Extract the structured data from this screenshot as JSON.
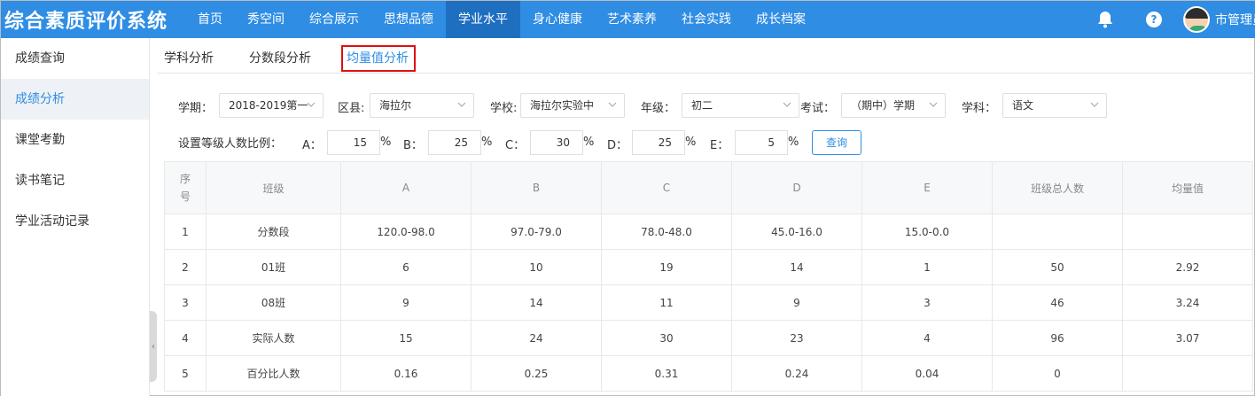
{
  "header": {
    "brand": "综合素质评价系统",
    "nav": [
      "首页",
      "秀空间",
      "综合展示",
      "思想品德",
      "学业水平",
      "身心健康",
      "艺术素养",
      "社会实践",
      "成长档案"
    ],
    "active_nav": "学业水平",
    "help_glyph": "?",
    "username": "市管理员",
    "icons": [
      "bell-icon",
      "help-icon",
      "avatar"
    ],
    "bg_color": "#2f8de4"
  },
  "sidebar": {
    "items": [
      "成绩查询",
      "成绩分析",
      "课堂考勤",
      "读书笔记",
      "学业活动记录"
    ],
    "active": "成绩分析",
    "collapse_glyph": "‹"
  },
  "tabs": {
    "items": [
      "学科分析",
      "分数段分析",
      "均量值分析"
    ],
    "active": "均量值分析"
  },
  "filters": {
    "term_label": "学期：",
    "term_value": "2018-2019第一",
    "district_label": "区县:",
    "district_value": "海拉尔",
    "school_label": "学校:",
    "school_value": "海拉尔实验中",
    "grade_label": "年级：",
    "grade_value": "初二",
    "exam_label": "考试：",
    "exam_value": "（期中）学期",
    "subject_label": "学科：",
    "subject_value": "语文",
    "ratio_label": "设置等级人数比例：",
    "ratios": [
      {
        "label": "A：",
        "value": "15",
        "unit": "%"
      },
      {
        "label": "B：",
        "value": "25",
        "unit": "%"
      },
      {
        "label": "C：",
        "value": "30",
        "unit": "%"
      },
      {
        "label": "D：",
        "value": "25",
        "unit": "%"
      },
      {
        "label": "E：",
        "value": "5",
        "unit": "%"
      }
    ],
    "query_label": "查询"
  },
  "table": {
    "headers": [
      "序号",
      "班级",
      "A",
      "B",
      "C",
      "D",
      "E",
      "班级总人数",
      "均量值"
    ],
    "rows": [
      [
        "1",
        "分数段",
        "120.0-98.0",
        "97.0-79.0",
        "78.0-48.0",
        "45.0-16.0",
        "15.0-0.0",
        "",
        ""
      ],
      [
        "2",
        "01班",
        "6",
        "10",
        "19",
        "14",
        "1",
        "50",
        "2.92"
      ],
      [
        "3",
        "08班",
        "9",
        "14",
        "11",
        "9",
        "3",
        "46",
        "3.24"
      ],
      [
        "4",
        "实际人数",
        "15",
        "24",
        "30",
        "23",
        "4",
        "96",
        "3.07"
      ],
      [
        "5",
        "百分比人数",
        "0.16",
        "0.25",
        "0.31",
        "0.24",
        "0.04",
        "0",
        ""
      ]
    ]
  }
}
